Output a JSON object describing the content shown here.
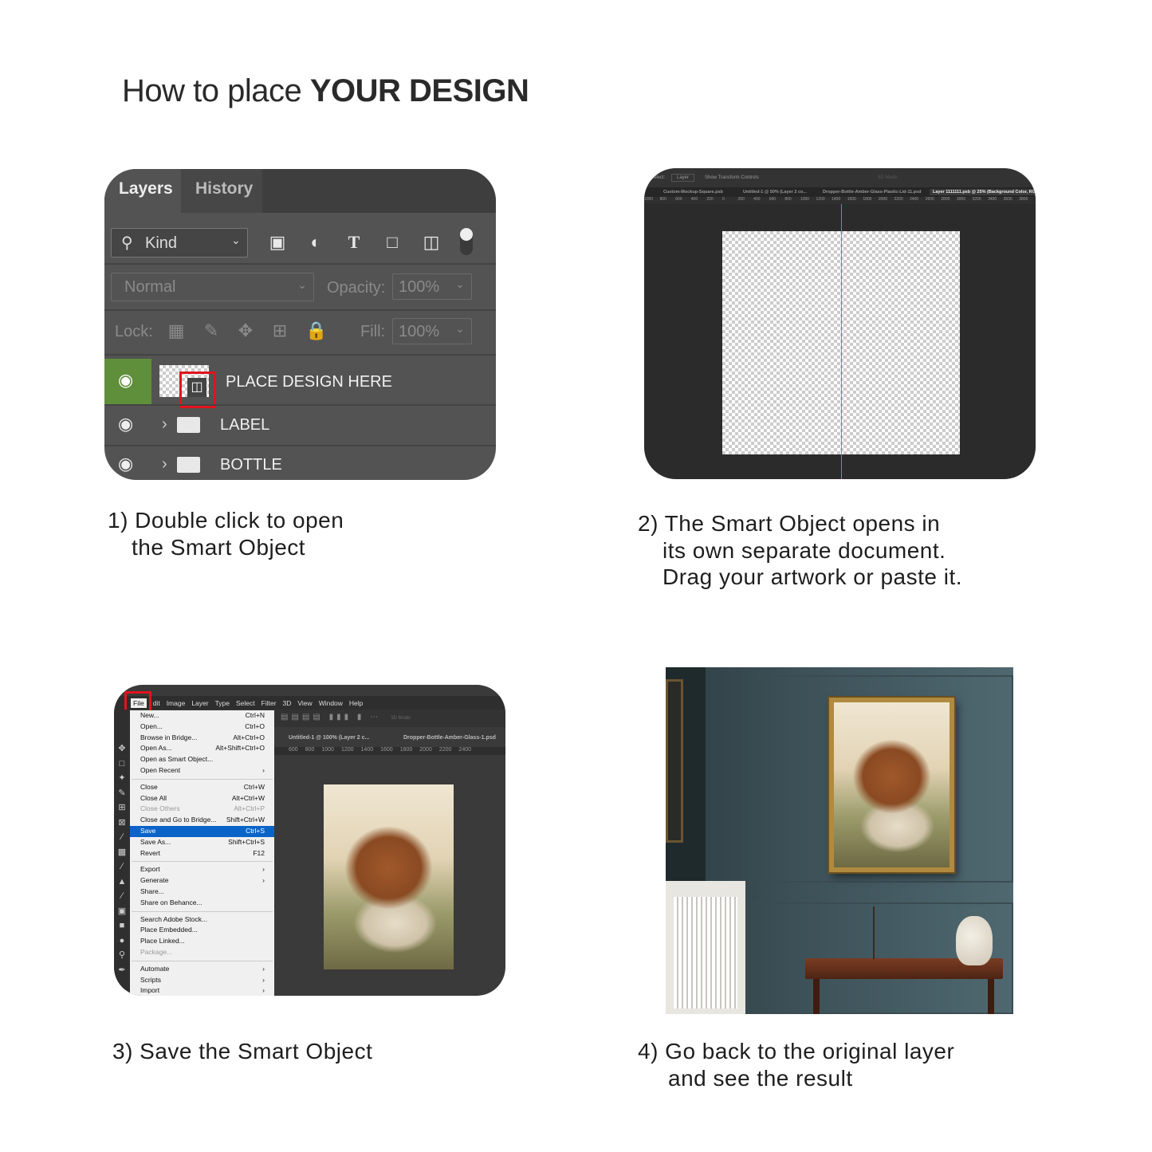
{
  "title": {
    "prefix": "How to place ",
    "emphasis": "YOUR DESIGN"
  },
  "step1": {
    "caption_line1": "1) Double click to open",
    "caption_line2": "the Smart Object",
    "panel": {
      "tabs": [
        "Layers",
        "History"
      ],
      "filter_label": "Kind",
      "blend_mode": "Normal",
      "opacity_label": "Opacity:",
      "opacity_value": "100%",
      "lock_label": "Lock:",
      "fill_label": "Fill:",
      "fill_value": "100%",
      "layers": [
        {
          "name": "PLACE DESIGN HERE",
          "type": "smart-object",
          "selected": true
        },
        {
          "name": "LABEL",
          "type": "group"
        },
        {
          "name": "BOTTLE",
          "type": "group"
        }
      ],
      "highlight_color": "#e0141e",
      "visible_color": "#5f8f3a"
    }
  },
  "step2": {
    "caption_line1": "2) The Smart Object opens in",
    "caption_line2": "its own separate document.",
    "caption_line3": "Drag your artwork or paste it.",
    "toolbar": {
      "select_label": "Select:",
      "select_value": "Layer",
      "transform": "Show Transform Controls",
      "mode": "3D Mode:"
    },
    "doc_tabs": [
      "Custom-Mockup-Square.psb",
      "Untitled-1 @ 50% (Layer 2 co...",
      "Dropper-Bottle-Amber-Glass-Plastic-Lid-11.psd",
      "Layer 1111111.psb @ 25% (Background Color, RG"
    ],
    "ruler": [
      "1000",
      "800",
      "600",
      "400",
      "200",
      "0",
      "200",
      "400",
      "600",
      "800",
      "1000",
      "1200",
      "1400",
      "1600",
      "1800",
      "2000",
      "2200",
      "2400",
      "2600",
      "2800",
      "3000",
      "3200",
      "3400",
      "3600",
      "3800"
    ]
  },
  "step3": {
    "caption": "3) Save the Smart Object",
    "menubar": [
      "File",
      "dit",
      "Image",
      "Layer",
      "Type",
      "Select",
      "Filter",
      "3D",
      "View",
      "Window",
      "Help"
    ],
    "doc_tabs": [
      "Untitled-1 @ 100% (Layer 2 c...",
      "Dropper-Bottle-Amber-Glass-1.psd"
    ],
    "ruler": [
      "600",
      "800",
      "1000",
      "1200",
      "1400",
      "1600",
      "1800",
      "2000",
      "2200",
      "2400"
    ],
    "mode": "3D Mode:",
    "menu_groups": [
      [
        {
          "label": "New...",
          "shortcut": "Ctrl+N"
        },
        {
          "label": "Open...",
          "shortcut": "Ctrl+O"
        },
        {
          "label": "Browse in Bridge...",
          "shortcut": "Alt+Ctrl+O"
        },
        {
          "label": "Open As...",
          "shortcut": "Alt+Shift+Ctrl+O"
        },
        {
          "label": "Open as Smart Object...",
          "shortcut": ""
        },
        {
          "label": "Open Recent",
          "shortcut": "›"
        }
      ],
      [
        {
          "label": "Close",
          "shortcut": "Ctrl+W"
        },
        {
          "label": "Close All",
          "shortcut": "Alt+Ctrl+W"
        },
        {
          "label": "Close Others",
          "shortcut": "Alt+Ctrl+P",
          "disabled": true
        },
        {
          "label": "Close and Go to Bridge...",
          "shortcut": "Shift+Ctrl+W"
        },
        {
          "label": "Save",
          "shortcut": "Ctrl+S",
          "highlighted": true
        },
        {
          "label": "Save As...",
          "shortcut": "Shift+Ctrl+S"
        },
        {
          "label": "Revert",
          "shortcut": "F12"
        }
      ],
      [
        {
          "label": "Export",
          "shortcut": "›"
        },
        {
          "label": "Generate",
          "shortcut": "›"
        },
        {
          "label": "Share...",
          "shortcut": ""
        },
        {
          "label": "Share on Behance...",
          "shortcut": ""
        }
      ],
      [
        {
          "label": "Search Adobe Stock...",
          "shortcut": ""
        },
        {
          "label": "Place Embedded...",
          "shortcut": ""
        },
        {
          "label": "Place Linked...",
          "shortcut": ""
        },
        {
          "label": "Package...",
          "shortcut": "",
          "disabled": true
        }
      ],
      [
        {
          "label": "Automate",
          "shortcut": "›"
        },
        {
          "label": "Scripts",
          "shortcut": "›"
        },
        {
          "label": "Import",
          "shortcut": "›"
        }
      ]
    ]
  },
  "step4": {
    "caption_line1": "4) Go back to the original layer",
    "caption_line2": "and see the result"
  }
}
